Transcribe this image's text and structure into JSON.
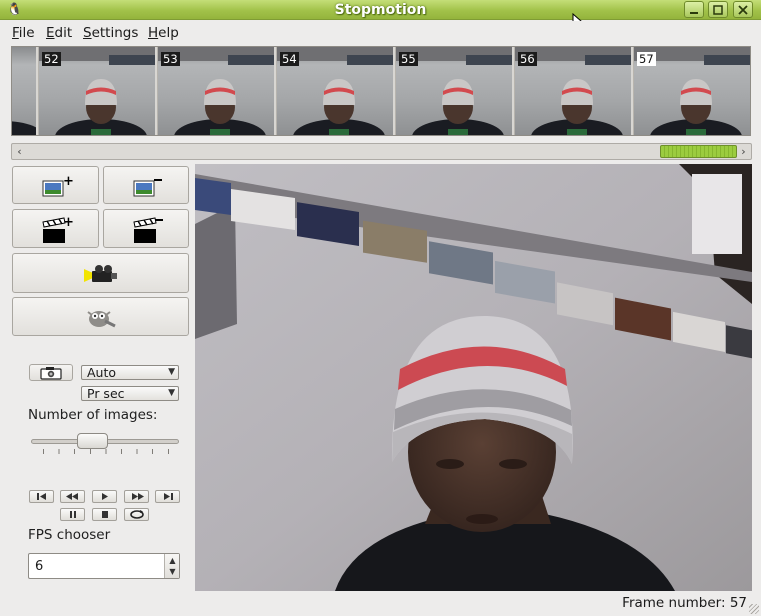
{
  "window": {
    "title": "Stopmotion"
  },
  "window_controls": [
    "minimize",
    "maximize",
    "close"
  ],
  "menu": [
    "File",
    "Edit",
    "Settings",
    "Help"
  ],
  "menu_mnemonics": [
    "F",
    "E",
    "S",
    "H"
  ],
  "frames": [
    {
      "number": "52",
      "selected": false
    },
    {
      "number": "53",
      "selected": false
    },
    {
      "number": "54",
      "selected": false
    },
    {
      "number": "55",
      "selected": false
    },
    {
      "number": "56",
      "selected": false
    },
    {
      "number": "57",
      "selected": true
    }
  ],
  "scrollbar": {
    "position": 0.95,
    "thumb_color": "#9bcc3f"
  },
  "tools": [
    {
      "icon": "add-frames-icon",
      "symbol": "+"
    },
    {
      "icon": "remove-frames-icon",
      "symbol": "−"
    },
    {
      "icon": "new-scene-icon",
      "symbol": "+"
    },
    {
      "icon": "remove-scene-icon",
      "symbol": "−"
    },
    {
      "icon": "camera-icon"
    },
    {
      "icon": "gimp-editor-icon"
    }
  ],
  "capture": {
    "mode_value": "Auto",
    "unit_value": "Pr sec",
    "mode_options": [
      "Auto"
    ],
    "unit_options": [
      "Pr sec"
    ]
  },
  "labels": {
    "number_of_images": "Number of images:",
    "fps_chooser": "FPS chooser"
  },
  "number_of_images_slider": {
    "value_fraction": 0.42
  },
  "playback_row1": [
    "first-frame",
    "previous-frame",
    "play",
    "next-frame",
    "last-frame"
  ],
  "playback_row2": [
    "pause",
    "stop",
    "loop"
  ],
  "fps": {
    "value": "6"
  },
  "status": {
    "text": "Frame number: 57"
  },
  "colors": {
    "titlebar": "#a2c24a",
    "accent": "#9bcc3f",
    "window_bg": "#edeceb"
  }
}
